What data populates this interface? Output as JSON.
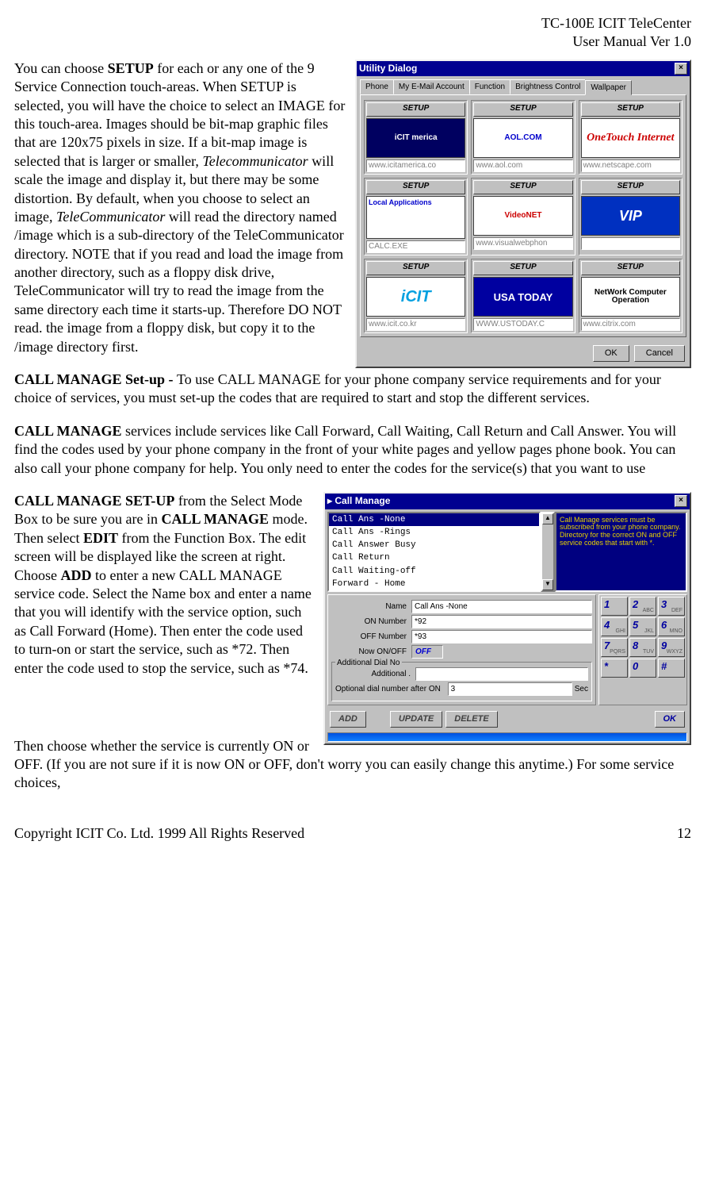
{
  "header": {
    "line1": "TC-100E ICIT TeleCenter",
    "line2": "User Manual  Ver 1.0"
  },
  "p1": {
    "pre": "You can choose ",
    "b1": "SETUP",
    "post1": " for each or any one of the 9 Service Connection touch-areas. When SETUP is selected, you will have the choice to select an IMAGE for this touch-area. Images should be bit-map graphic files that are 120x75 pixels in size. If a bit-map image is selected that is larger or smaller, ",
    "i1": "Telecommunicator",
    "post2": " will scale the image and display it, but there may be some distortion. By default, when you choose to select an image, ",
    "i2": "TeleCommunicator",
    "post3": " will read the directory named /image which is a sub-directory of the TeleCommunicator directory. NOTE that if you read and load the image from another directory, such as a floppy disk drive, TeleCommunicator will try to read the image from the same directory each time it starts-up. Therefore DO NOT read. the image from a floppy disk, but copy it to the /image directory first."
  },
  "p2": {
    "b": "CALL MANAGE Set-up - ",
    "rest": " To use CALL MANAGE for your phone company service requirements and for your choice of services, you must set-up the codes that are required to start and stop the different services."
  },
  "p3": {
    "b": "CALL MANAGE",
    "rest": "  services include services like Call Forward, Call Waiting, Call Return and Call Answer. You will find the codes used by your phone company in the front of your  white pages and yellow pages phone book. You can also call your phone company for help. You only need to enter the  codes for the service(s) that you want to use"
  },
  "p4": {
    "b1": "CALL MANAGE SET-UP",
    "t1": "  from the  Select Mode Box to be sure you are in ",
    "b2": "CALL MANAGE",
    "t2": " mode. Then select ",
    "b3": "EDIT",
    "t3": " from the Function Box. The edit screen will be displayed like the screen at right. Choose ",
    "b4": "ADD",
    "t4": " to enter a new CALL MANAGE  service code. Select the Name box and enter  a name that you will identify with the service option, such as Call Forward (Home). Then enter the code used to turn-on or start the service, such as *72. Then enter the code used to stop the service, such as *74."
  },
  "p5": "Then choose whether the service is currently ON or OFF. (If you are not sure if it is now ON or OFF, don't worry you can easily change this anytime.) For some service choices,",
  "footer": {
    "copyright": "Copyright ICIT Co. Ltd. 1999  All Rights Reserved",
    "page": "12"
  },
  "dlg1": {
    "title": "Utility Dialog",
    "close": "×",
    "tabs": [
      "Phone",
      "My E-Mail Account",
      "Function",
      "Brightness Control",
      "Wallpaper"
    ],
    "setup": "SETUP",
    "cells": [
      {
        "txt": "iCIT merica",
        "url": "www.icitamerica.co"
      },
      {
        "txt": "AOL.COM",
        "url": "www.aol.com"
      },
      {
        "txt": "OneTouch Internet",
        "url": "www.netscape.com"
      },
      {
        "txt": "Local Applications",
        "url": "CALC.EXE"
      },
      {
        "txt": "VideoNET",
        "url": "www.visualwebphon"
      },
      {
        "txt": "VIP",
        "url": ""
      },
      {
        "txt": "iCIT",
        "url": "www.icit.co.kr"
      },
      {
        "txt": "USA TODAY",
        "url": "WWW.USTODAY.C"
      },
      {
        "txt": "NetWork Computer Operation",
        "url": "www.citrix.com"
      }
    ],
    "ok": "OK",
    "cancel": "Cancel"
  },
  "dlg2": {
    "title": "Call Manage",
    "close": "×",
    "list": [
      "Call Ans -None",
      "Call Ans -Rings",
      "Call Answer Busy",
      "Call Return",
      "Call Waiting-off",
      "Forward - Home"
    ],
    "help": "Call Manage services must be subscribed from your phone company. Directory for the correct ON and OFF service codes that start with *.",
    "labels": {
      "name": "Name",
      "on": "ON Number",
      "off": "OFF Number",
      "now": "Now ON/OFF",
      "grp": "Additional Dial No",
      "add": "Additional .",
      "opt": "Optional dial number after ON",
      "sec": "Sec"
    },
    "values": {
      "name": "Call Ans -None",
      "on": "*92",
      "off": "*93",
      "now": "OFF",
      "opt": "3"
    },
    "keys": [
      [
        "1",
        ""
      ],
      [
        "2",
        "ABC"
      ],
      [
        "3",
        "DEF"
      ],
      [
        "4",
        "GHI"
      ],
      [
        "5",
        "JKL"
      ],
      [
        "6",
        "MNO"
      ],
      [
        "7",
        "PQRS"
      ],
      [
        "8",
        "TUV"
      ],
      [
        "9",
        "WXYZ"
      ],
      [
        "*",
        ""
      ],
      [
        "0",
        ""
      ],
      [
        "#",
        ""
      ]
    ],
    "btns": {
      "add": "ADD",
      "update": "UPDATE",
      "delete": "DELETE",
      "ok": "OK"
    }
  }
}
